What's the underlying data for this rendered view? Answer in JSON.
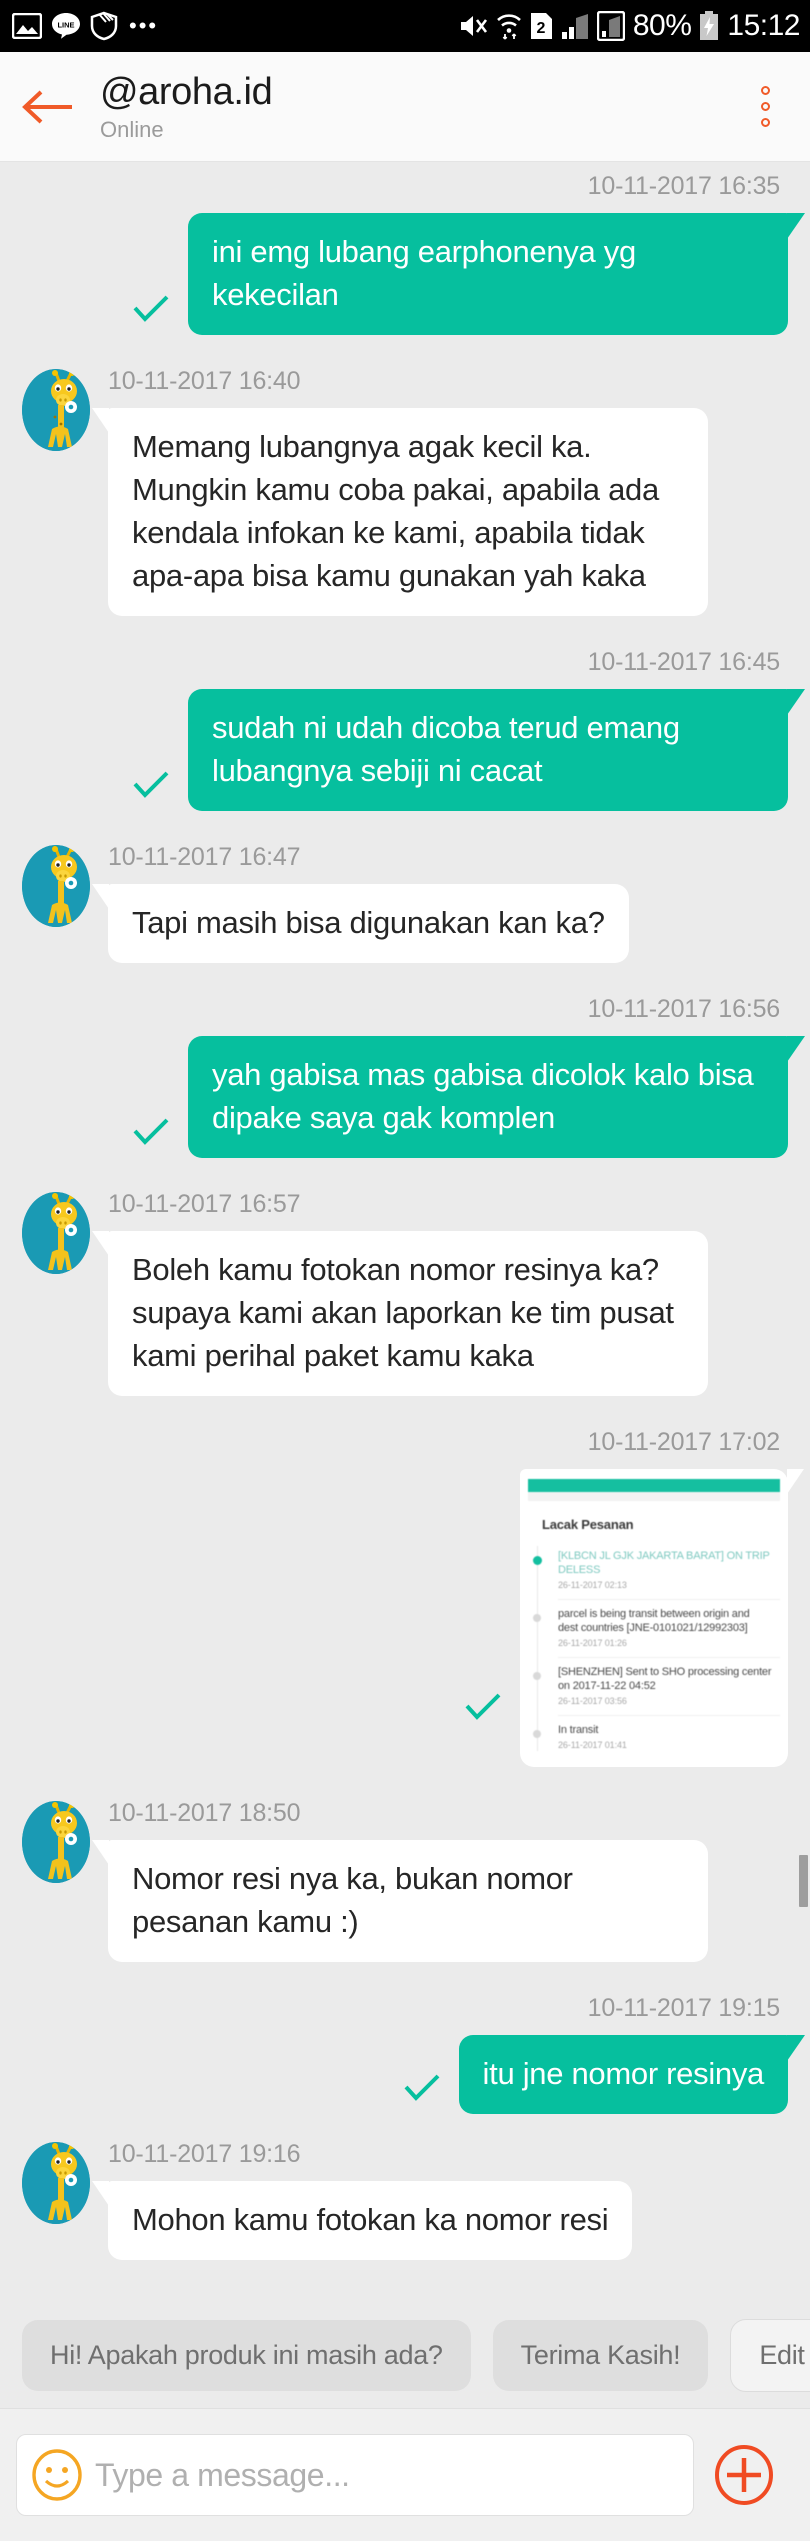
{
  "status_bar": {
    "left_icons": [
      "image-icon",
      "line-app-icon",
      "shield-icon",
      "more-dots-icon"
    ],
    "right_icons": [
      "mute-icon",
      "wifi-icon",
      "sim2-icon",
      "signal-icon",
      "signal-2-icon",
      "battery-charging-icon"
    ],
    "battery_percent": "80%",
    "clock": "15:12",
    "sim_label": "2"
  },
  "header": {
    "back_icon": "arrow-left-icon",
    "title": "@aroha.id",
    "subtitle": "Online",
    "menu_icon": "more-vertical-icon",
    "accent_color": "#f05a28"
  },
  "theme": {
    "outgoing_bubble": "#06bf9e",
    "incoming_bubble": "#ffffff",
    "chat_background": "#ebebeb",
    "avatar_background": "#1a9ab4",
    "tick_color": "#06bf9e"
  },
  "messages": [
    {
      "direction": "out",
      "timestamp": "10-11-2017 16:35",
      "text": "ini emg lubang earphonenya yg kekecilan",
      "status_icon": "check-icon"
    },
    {
      "direction": "in",
      "timestamp": "10-11-2017 16:40",
      "text": "Memang lubangnya agak kecil ka. Mungkin kamu coba pakai, apabila ada kendala infokan ke kami, apabila tidak apa-apa bisa kamu gunakan yah kaka",
      "avatar_icon": "giraffe-avatar"
    },
    {
      "direction": "out",
      "timestamp": "10-11-2017 16:45",
      "text": "sudah ni udah dicoba terud emang lubangnya sebiji ni cacat",
      "status_icon": "check-icon"
    },
    {
      "direction": "in",
      "timestamp": "10-11-2017 16:47",
      "text": "Tapi masih bisa digunakan kan ka?",
      "avatar_icon": "giraffe-avatar"
    },
    {
      "direction": "out",
      "timestamp": "10-11-2017 16:56",
      "text": "yah gabisa mas gabisa dicolok kalo bisa dipake saya gak komplen",
      "status_icon": "check-icon"
    },
    {
      "direction": "in",
      "timestamp": "10-11-2017 16:57",
      "text": "Boleh kamu fotokan nomor resinya ka? supaya kami akan laporkan ke tim pusat kami perihal paket kamu kaka",
      "avatar_icon": "giraffe-avatar"
    },
    {
      "direction": "out",
      "timestamp": "10-11-2017 17:02",
      "type": "image",
      "status_icon": "check-icon",
      "attachment": {
        "kind": "order-tracking-screenshot",
        "title": "Lacak Pesanan",
        "events": [
          {
            "text": "[KLBCN JL GJK JAKARTA BARAT] ON TRIP DELESS",
            "date": "26-11-2017 02:13",
            "active": true
          },
          {
            "text": "parcel is being transit between origin and dest countries [JNE-0101021/12992303]",
            "date": "26-11-2017 01:26",
            "active": false
          },
          {
            "text": "[SHENZHEN] Sent to SHO processing center on 2017-11-22 04:52",
            "date": "26-11-2017 03:56",
            "active": false
          },
          {
            "text": "In transit",
            "date": "26-11-2017 01:41",
            "active": false
          }
        ]
      }
    },
    {
      "direction": "in",
      "timestamp": "10-11-2017 18:50",
      "text": "Nomor resi nya ka, bukan nomor pesanan kamu :)",
      "avatar_icon": "giraffe-avatar"
    },
    {
      "direction": "out",
      "timestamp": "10-11-2017 19:15",
      "text": "itu jne nomor resinya",
      "status_icon": "check-icon"
    },
    {
      "direction": "in",
      "timestamp": "10-11-2017 19:16",
      "text": "Mohon kamu fotokan ka nomor resi",
      "avatar_icon": "giraffe-avatar"
    }
  ],
  "quick_replies": [
    {
      "label": "Hi! Apakah produk ini masih ada?",
      "style": "filled"
    },
    {
      "label": "Terima Kasih!",
      "style": "filled"
    },
    {
      "label": "Edit",
      "style": "outline"
    }
  ],
  "input_bar": {
    "emoji_icon": "smiley-icon",
    "placeholder": "Type a message...",
    "value": "",
    "attach_icon": "plus-circle-icon",
    "attach_color": "#f04b23"
  }
}
